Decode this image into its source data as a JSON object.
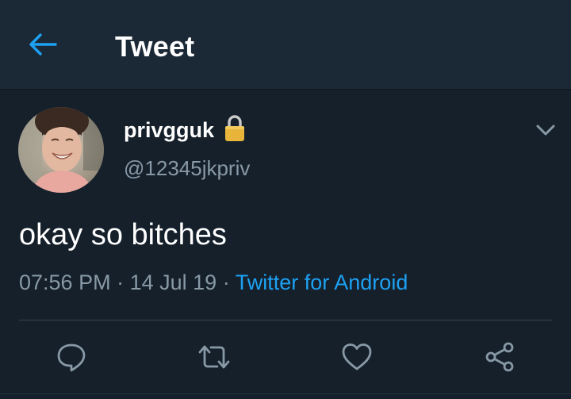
{
  "header": {
    "title": "Tweet",
    "back_icon": "arrow-left-icon"
  },
  "tweet": {
    "display_name": "privgguk",
    "handle": "@12345jkpriv",
    "protected_icon": "lock-icon",
    "text": "okay so bitches",
    "time": "07:56 PM",
    "separator_1": "·",
    "date": "14 Jul 19",
    "separator_2": "·",
    "source": "Twitter for Android"
  },
  "actions": [
    "reply-icon",
    "retweet-icon",
    "like-icon",
    "share-icon"
  ],
  "colors": {
    "background": "#15202b",
    "header_background": "#1b2836",
    "accent": "#1da1f2",
    "secondary_text": "#8899a6",
    "lock": "#e8b53a"
  }
}
